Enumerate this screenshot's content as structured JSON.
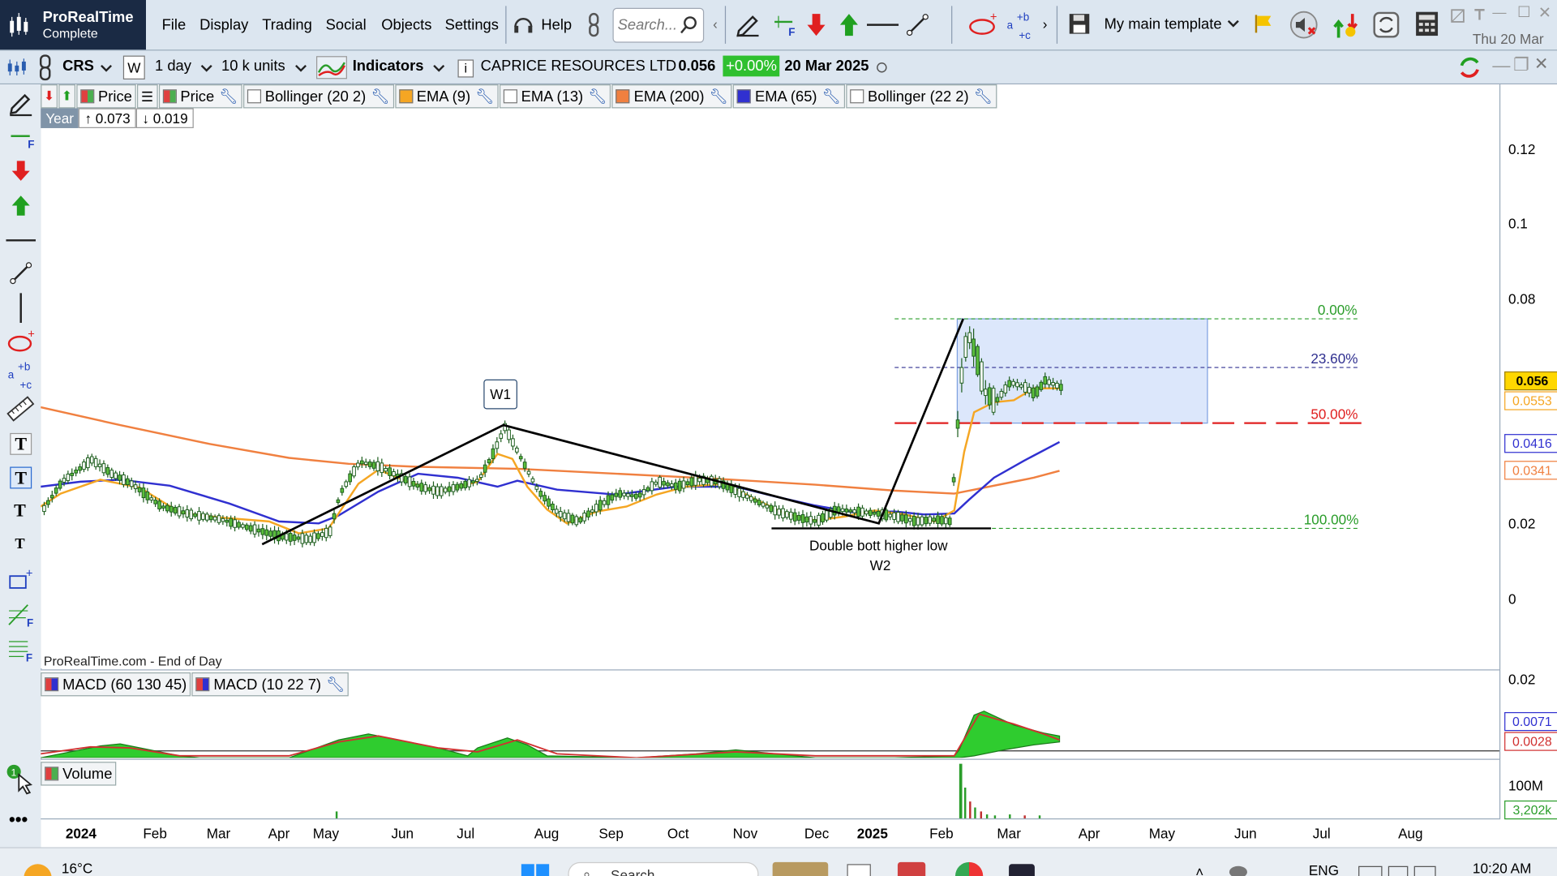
{
  "app": {
    "name": "ProRealTime",
    "edition": "Complete"
  },
  "menu": [
    "File",
    "Display",
    "Trading",
    "Social",
    "Objects",
    "Settings"
  ],
  "help_label": "Help",
  "search": {
    "placeholder": "Search..."
  },
  "template": {
    "label": "My main template"
  },
  "clock_date": "Thu 20 Mar",
  "toolbar2": {
    "ticker": "CRS",
    "period_letter": "W",
    "timeframe": "1 day",
    "units": "10 k units",
    "indicators_label": "Indicators",
    "instrument": "CAPRICE RESOURCES LTD",
    "last_price": "0.056",
    "change": "+0.00%",
    "date": "20 Mar 2025"
  },
  "indicator_chips": [
    {
      "label": "Price",
      "color": "#4caf50"
    },
    {
      "label": "Price",
      "color": "#4caf50"
    },
    {
      "label": "Bollinger (20 2)",
      "color": "#ffffff"
    },
    {
      "label": "EMA (9)",
      "color": "#f5a623"
    },
    {
      "label": "EMA (13)",
      "color": "#ffffff"
    },
    {
      "label": "EMA (200)",
      "color": "#f08040"
    },
    {
      "label": "EMA (65)",
      "color": "#3030d0"
    },
    {
      "label": "Bollinger (22 2)",
      "color": "#ffffff"
    }
  ],
  "year_box": {
    "label": "Year",
    "high": "0.073",
    "low": "0.019"
  },
  "annotations": {
    "w1": "W1",
    "double_bottom": "Double bott higher low",
    "w2": "W2",
    "source": "ProRealTime.com - End of Day"
  },
  "fib_levels": [
    "0.00%",
    "23.60%",
    "50.00%",
    "100.00%"
  ],
  "y_axis_ticks": [
    "0.12",
    "0.1",
    "0.08",
    "0.02",
    "0"
  ],
  "price_tags": [
    {
      "value": "0.056",
      "bg": "#ffd700",
      "fg": "#000000"
    },
    {
      "value": "0.0553",
      "bg": "#ffffff",
      "fg": "#f5a623"
    },
    {
      "value": "0.0416",
      "bg": "#ffffff",
      "fg": "#3030d0"
    },
    {
      "value": "0.0341",
      "bg": "#ffffff",
      "fg": "#f08040"
    }
  ],
  "macd": {
    "chips": [
      "MACD (60 130 45)",
      "MACD (10 22 7)"
    ],
    "tick": "0.02",
    "tags": [
      {
        "value": "0.0071",
        "fg": "#3030d0"
      },
      {
        "value": "0.0028",
        "fg": "#d03030"
      }
    ]
  },
  "volume": {
    "label": "Volume",
    "tick": "100M",
    "tag": "3,202k"
  },
  "x_axis": [
    "2024",
    "Feb",
    "Mar",
    "Apr",
    "May",
    "Jun",
    "Jul",
    "Aug",
    "Sep",
    "Oct",
    "Nov",
    "Dec",
    "2025",
    "Feb",
    "Mar",
    "Apr",
    "May",
    "Jun",
    "Jul",
    "Aug"
  ],
  "taskbar": {
    "temp": "16°C",
    "search": "Search",
    "lang": "ENG",
    "time": "10:20 AM"
  },
  "chart_data": {
    "type": "candlestick",
    "series": [
      {
        "name": "EMA (9)",
        "color": "#f5a623"
      },
      {
        "name": "EMA (65)",
        "color": "#3030d0"
      },
      {
        "name": "EMA (200)",
        "color": "#f08040"
      }
    ],
    "ylim": [
      0,
      0.12
    ],
    "last": 0.056,
    "fibonacci": {
      "0.00%": 0.075,
      "23.60%": 0.0635,
      "50.00%": 0.0475,
      "100.00%": 0.019
    }
  }
}
